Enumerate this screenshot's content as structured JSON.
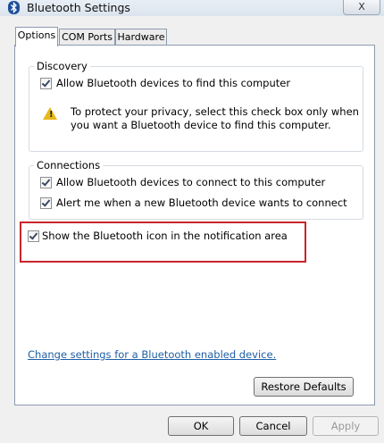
{
  "window": {
    "title": "Bluetooth Settings",
    "close_label": "X"
  },
  "tabs": [
    {
      "label": "Options",
      "active": true
    },
    {
      "label": "COM Ports",
      "active": false
    },
    {
      "label": "Hardware",
      "active": false
    }
  ],
  "discovery": {
    "title": "Discovery",
    "allow_find_label": "Allow Bluetooth devices to find this computer",
    "allow_find_checked": true,
    "warning_line1": "To protect your privacy, select this check box only when",
    "warning_line2": "you want a Bluetooth device to find this computer."
  },
  "connections": {
    "title": "Connections",
    "allow_connect_label": "Allow Bluetooth devices to connect to this computer",
    "allow_connect_checked": true,
    "alert_label": "Alert me when a new Bluetooth device wants to connect",
    "alert_checked": true
  },
  "show_icon": {
    "label": "Show the Bluetooth icon in the notification area",
    "checked": true
  },
  "link_text": "Change settings for a Bluetooth enabled device.",
  "buttons": {
    "restore_defaults": "Restore Defaults",
    "ok": "OK",
    "cancel": "Cancel",
    "apply": "Apply"
  },
  "colors": {
    "highlight_border": "#c9242c",
    "link": "#1f5fa6",
    "warning_icon": "#e7b91c"
  },
  "icons": {
    "title": "bluetooth-icon",
    "warning": "warning-icon",
    "check": "checkmark-icon"
  }
}
